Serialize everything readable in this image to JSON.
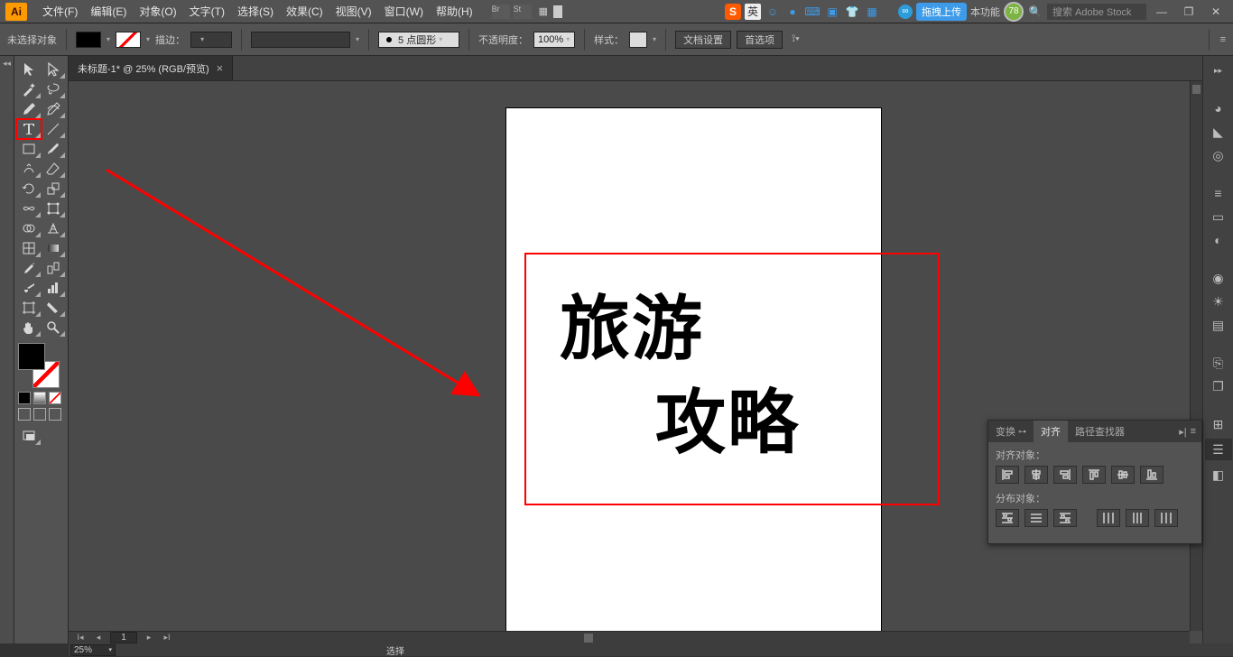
{
  "menu": {
    "items": [
      "文件(F)",
      "编辑(E)",
      "对象(O)",
      "文字(T)",
      "选择(S)",
      "效果(C)",
      "视图(V)",
      "窗口(W)",
      "帮助(H)"
    ]
  },
  "tray": {
    "ime": "英",
    "pill": "拖拽上传",
    "func": "本功能",
    "badge": "78",
    "search_placeholder": "搜索 Adobe Stock"
  },
  "optbar": {
    "no_selection": "未选择对象",
    "stroke_label": "描边：",
    "brush_label": "5 点圆形",
    "opacity_label": "不透明度：",
    "opacity_value": "100%",
    "style_label": "样式：",
    "doc_setup": "文档设置",
    "prefs": "首选项"
  },
  "doc": {
    "tab_title": "未标题-1* @ 25% (RGB/预览)",
    "text1": "旅游",
    "text2": "攻略",
    "page": "1"
  },
  "align_panel": {
    "tab_transform": "变换",
    "tab_align": "对齐",
    "tab_pathfinder": "路径查找器",
    "sect_align": "对齐对象：",
    "sect_distribute": "分布对象："
  },
  "status": {
    "zoom": "25%",
    "mode": "选择"
  }
}
